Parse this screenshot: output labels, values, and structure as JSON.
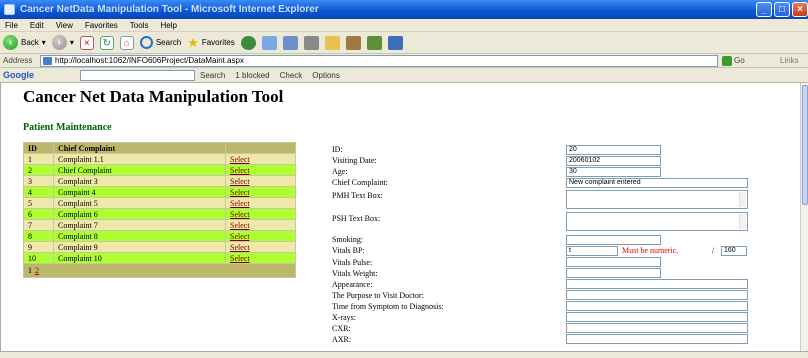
{
  "window": {
    "title": "Cancer NetData Manipulation Tool - Microsoft Internet Explorer"
  },
  "menu": [
    "File",
    "Edit",
    "View",
    "Favorites",
    "Tools",
    "Help"
  ],
  "toolbar": {
    "back": "Back",
    "search": "Search",
    "favorites": "Favorites"
  },
  "address": {
    "label": "Address",
    "url": "http://localhost:1062/INFO606Project/DataMaint.aspx",
    "go": "Go",
    "links": "Links"
  },
  "googlebar": {
    "logo": "Google",
    "search": "Search",
    "blocked": "1 blocked",
    "check": "Check",
    "options": "Options"
  },
  "page": {
    "title": "Cancer Net Data Manipulation Tool",
    "section": "Patient Maintenance"
  },
  "grid": {
    "headers": [
      "ID",
      "Chief Complaint"
    ],
    "rows": [
      {
        "id": "1",
        "complaint": "Complaint 1.1",
        "action": "Select"
      },
      {
        "id": "2",
        "complaint": "Chief Complaint",
        "action": "Select"
      },
      {
        "id": "3",
        "complaint": "Complaint 3",
        "action": "Select"
      },
      {
        "id": "4",
        "complaint": "Compaint 4",
        "action": "Select"
      },
      {
        "id": "5",
        "complaint": "Complaint 5",
        "action": "Select"
      },
      {
        "id": "6",
        "complaint": "Complaint 6",
        "action": "Select"
      },
      {
        "id": "7",
        "complaint": "Complaint 7",
        "action": "Select"
      },
      {
        "id": "8",
        "complaint": "Complaint 8",
        "action": "Select"
      },
      {
        "id": "9",
        "complaint": "Complaint 9",
        "action": "Select"
      },
      {
        "id": "10",
        "complaint": "Complaint 10",
        "action": "Select"
      }
    ],
    "pager": {
      "current": "1",
      "next": "2"
    }
  },
  "form": {
    "id": {
      "label": "ID:",
      "value": "20"
    },
    "visiting_date": {
      "label": "Visiting Date:",
      "value": "20060102"
    },
    "age": {
      "label": "Age:",
      "value": "30"
    },
    "chief_complaint": {
      "label": "Chief Complaint:",
      "value": "New complaint entered"
    },
    "pmh": {
      "label": "PMH Text Box:",
      "value": ""
    },
    "psh": {
      "label": "PSH Text Box:",
      "value": ""
    },
    "smoking": {
      "label": "Smoking:",
      "value": ""
    },
    "vitals_bp": {
      "label": "Vitals BP:",
      "value": "t",
      "error": "Must be numeric.",
      "separator": "/",
      "value2": "160"
    },
    "vitals_pulse": {
      "label": "Vitals Pulse:",
      "value": ""
    },
    "vitals_weight": {
      "label": "Vitals Weight:",
      "value": ""
    },
    "appearance": {
      "label": "Appearance:",
      "value": ""
    },
    "purpose": {
      "label": "The Purpose to Visit Doctor:",
      "value": ""
    },
    "time_symptom": {
      "label": "Time from Symptom to Diagnosis:",
      "value": ""
    },
    "xrays": {
      "label": "X-rays:",
      "value": ""
    },
    "cxr": {
      "label": "CXR:",
      "value": ""
    },
    "axr": {
      "label": "AXR:",
      "value": ""
    }
  }
}
